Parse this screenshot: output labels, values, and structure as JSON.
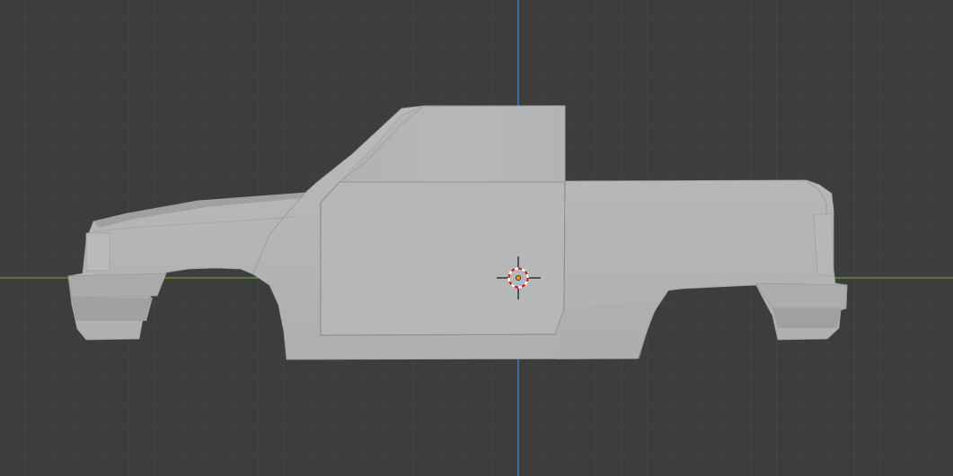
{
  "viewport": {
    "background_color": "#3d3d3d",
    "grid_minor_color": "#474747",
    "grid_major_color": "#4f4f4f",
    "axis_x_color": "#6a9a2a",
    "axis_y_color": "#3f7fc2",
    "mesh_color": "#b3b4b5"
  },
  "objects": {
    "mesh": "pickup-truck-body",
    "cursor_icon": "3d-cursor-icon",
    "origin_icon": "object-origin-icon"
  }
}
